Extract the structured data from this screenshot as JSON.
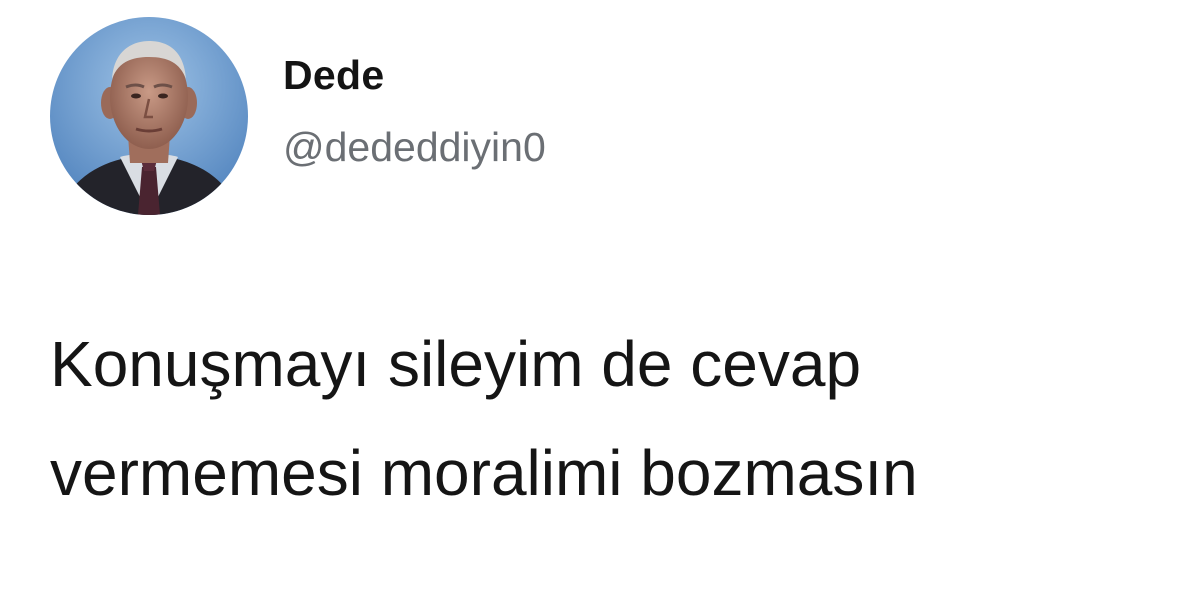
{
  "tweet": {
    "author": {
      "display_name": "Dede",
      "handle": "@dededdiyin0",
      "avatar_icon": "profile-photo-elderly-man"
    },
    "text_lines": [
      "Konuşmayı sileyim de cevap",
      "vermemesi moralimi bozmasın"
    ]
  }
}
